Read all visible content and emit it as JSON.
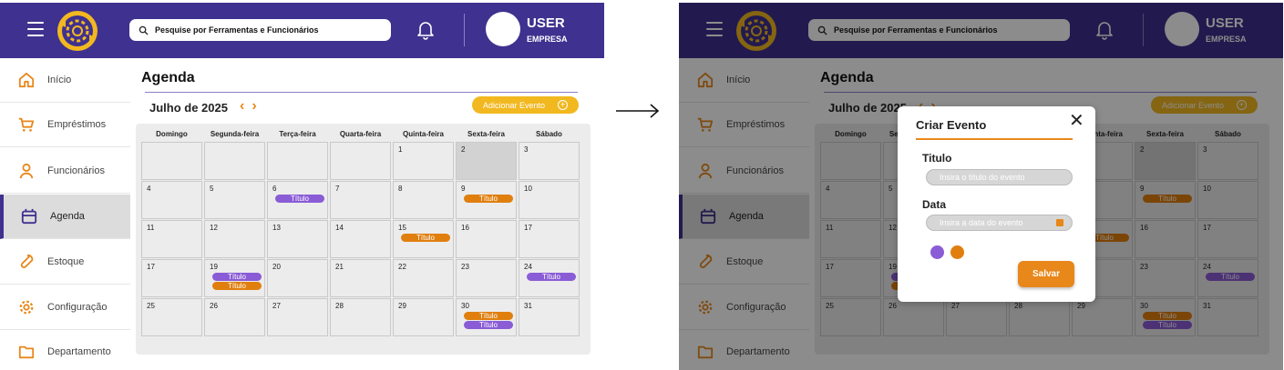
{
  "header": {
    "search_placeholder": "Pesquise por Ferramentas e Funcionários",
    "user_name": "USER",
    "user_company": "EMPRESA"
  },
  "sidebar": {
    "items": [
      {
        "label": "Início",
        "icon": "home-icon"
      },
      {
        "label": "Empréstimos",
        "icon": "cart-icon"
      },
      {
        "label": "Funcionários",
        "icon": "user-icon"
      },
      {
        "label": "Agenda",
        "icon": "calendar-icon",
        "active": true
      },
      {
        "label": "Estoque",
        "icon": "wrench-icon"
      },
      {
        "label": "Configuração",
        "icon": "gear-icon"
      },
      {
        "label": "Departamento",
        "icon": "folder-icon"
      }
    ]
  },
  "page": {
    "title": "Agenda",
    "month": "Julho de 2025",
    "add_event_label": "Adicionar Evento"
  },
  "calendar": {
    "weekdays": [
      "Domingo",
      "Segunda-feira",
      "Terça-feira",
      "Quarta-feira",
      "Quinta-feira",
      "Sexta-feira",
      "Sábado"
    ],
    "weeks": [
      [
        {
          "day": ""
        },
        {
          "day": ""
        },
        {
          "day": ""
        },
        {
          "day": ""
        },
        {
          "day": "1"
        },
        {
          "day": "2",
          "today": true
        },
        {
          "day": "3"
        }
      ],
      [
        {
          "day": "4"
        },
        {
          "day": "5"
        },
        {
          "day": "6",
          "events": [
            {
              "label": "Título",
              "color": "purple"
            }
          ]
        },
        {
          "day": "7"
        },
        {
          "day": "8"
        },
        {
          "day": "9",
          "events": [
            {
              "label": "Título",
              "color": "orange"
            }
          ]
        },
        {
          "day": "10"
        }
      ],
      [
        {
          "day": "11"
        },
        {
          "day": "12"
        },
        {
          "day": "13"
        },
        {
          "day": "14"
        },
        {
          "day": "15",
          "events": [
            {
              "label": "Título",
              "color": "orange"
            }
          ]
        },
        {
          "day": "16"
        },
        {
          "day": "17"
        }
      ],
      [
        {
          "day": "17"
        },
        {
          "day": "19",
          "events": [
            {
              "label": "Título",
              "color": "purple"
            },
            {
              "label": "Título",
              "color": "orange"
            }
          ]
        },
        {
          "day": "20"
        },
        {
          "day": "21"
        },
        {
          "day": "22"
        },
        {
          "day": "23"
        },
        {
          "day": "24",
          "events": [
            {
              "label": "Título",
              "color": "purple"
            }
          ]
        }
      ],
      [
        {
          "day": "25"
        },
        {
          "day": "26"
        },
        {
          "day": "27"
        },
        {
          "day": "28"
        },
        {
          "day": "29"
        },
        {
          "day": "30",
          "events": [
            {
              "label": "Título",
              "color": "orange"
            },
            {
              "label": "Título",
              "color": "purple"
            }
          ]
        },
        {
          "day": "31"
        }
      ]
    ]
  },
  "modal": {
    "title": "Criar Evento",
    "close_glyph": "✕",
    "title_label": "Titulo",
    "title_placeholder": "Insira o título do evento",
    "date_label": "Data",
    "date_placeholder": "Insira a data do evento",
    "save_label": "Salvar",
    "colors": [
      "#8a5cd6",
      "#e07f0e"
    ]
  },
  "colors": {
    "header": "#3f318f",
    "accent_orange": "#e8871a",
    "add_button": "#f2b820",
    "event_purple": "#8a5cd6",
    "event_orange": "#e07f0e"
  }
}
